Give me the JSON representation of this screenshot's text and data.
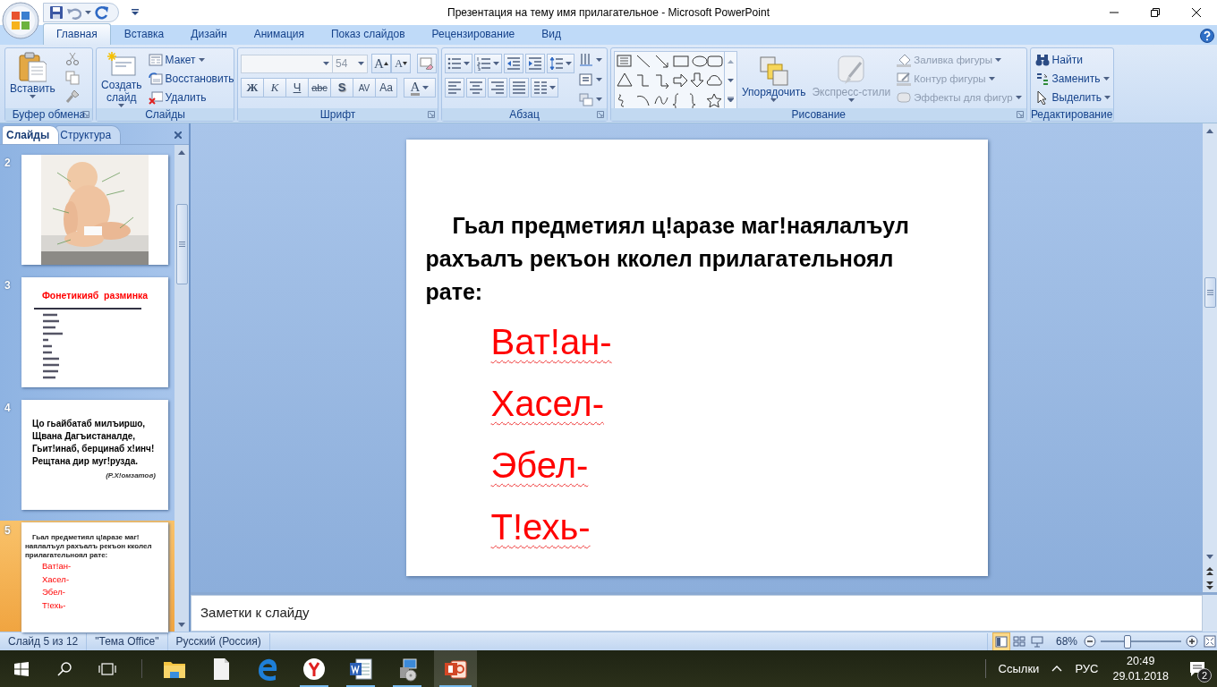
{
  "window": {
    "title": "Презентация на тему имя прилагательное - Microsoft PowerPoint"
  },
  "ribbon_tabs": [
    {
      "label": "Главная",
      "selected": true
    },
    {
      "label": "Вставка",
      "selected": false
    },
    {
      "label": "Дизайн",
      "selected": false
    },
    {
      "label": "Анимация",
      "selected": false
    },
    {
      "label": "Показ слайдов",
      "selected": false
    },
    {
      "label": "Рецензирование",
      "selected": false
    },
    {
      "label": "Вид",
      "selected": false
    }
  ],
  "clipboard": {
    "label": "Буфер обмена",
    "paste": "Вставить"
  },
  "slides_group": {
    "label": "Слайды",
    "new_slide": "Создать слайд",
    "buttons": [
      "Макет",
      "Восстановить",
      "Удалить"
    ]
  },
  "font": {
    "label": "Шрифт",
    "size": "54",
    "grow_shrink": [
      "A",
      "A"
    ],
    "format_buttons": [
      "Ж",
      "К",
      "Ч",
      "abc",
      "S",
      "AV",
      "Aa"
    ],
    "color_button": "A"
  },
  "paragraph": {
    "label": "Абзац"
  },
  "drawing": {
    "label": "Рисование",
    "arrange": "Упорядочить",
    "quick_styles": {
      "label": "Экспресс-стили",
      "disabled": true
    },
    "shape_buttons": [
      {
        "label": "Заливка фигуры",
        "disabled": true
      },
      {
        "label": "Контур фигуры",
        "disabled": true
      },
      {
        "label": "Эффекты для фигур",
        "disabled": true
      }
    ]
  },
  "editing": {
    "label": "Редактирование",
    "buttons": [
      "Найти",
      "Заменить",
      "Выделить"
    ]
  },
  "panel": {
    "tabs": [
      {
        "label": "Слайды",
        "selected": true
      },
      {
        "label": "Структура",
        "selected": false
      }
    ],
    "thumbnails": [
      {
        "number": "2",
        "kind": "picture",
        "selected": false
      },
      {
        "number": "3",
        "kind": "title",
        "title": "Фонетикияб  разминка",
        "selected": false
      },
      {
        "number": "4",
        "kind": "poem",
        "lines": [
          "Цо гьайбатаб милъиршо,",
          "Щвана Дагъистаналде,",
          "Гьит!инаб, берцинаб х!инч!",
          "Рещтана дир муг!рузда."
        ],
        "author": "(Р.Х!омзатов)",
        "selected": false
      },
      {
        "number": "5",
        "kind": "list",
        "paragraph": "Гьал предметиял ц!аразе маг!наялалъул рахъалъ рекъон кколел прилагательноял рате:",
        "items": [
          "Ват!ан-",
          "Хасел-",
          "Эбел-",
          "Т!ехь-"
        ],
        "selected": true
      }
    ]
  },
  "slide": {
    "paragraph": "Гьал предметиял ц!аразе маг!наялалъул рахъалъ рекъон кколел прилагательноял рате:",
    "items": [
      "Ват!ан-",
      "Хасел-",
      "Эбел-",
      "Т!ехь-"
    ]
  },
  "notes": {
    "placeholder": "Заметки к слайду"
  },
  "status_bar": {
    "slide": "Слайд 5 из 12",
    "theme": "\"Тема Office\"",
    "language": "Русский (Россия)",
    "views": [
      {
        "kind": "normal",
        "selected": true
      },
      {
        "kind": "sorter",
        "selected": false
      },
      {
        "kind": "show",
        "selected": false
      }
    ],
    "zoom": "68%",
    "zoom_slider": {
      "level": 0.33
    }
  },
  "taskbar": {
    "apps": [
      {
        "kind": "explorer",
        "running": false,
        "selected": false
      },
      {
        "kind": "file",
        "running": false,
        "selected": false
      },
      {
        "kind": "edge",
        "running": false,
        "selected": false
      },
      {
        "kind": "yandex",
        "running": true,
        "selected": false
      },
      {
        "kind": "word",
        "running": true,
        "selected": false
      },
      {
        "kind": "installer",
        "running": true,
        "selected": false
      },
      {
        "kind": "powerpoint",
        "running": true,
        "selected": true
      }
    ],
    "links": "Ссылки",
    "language": "РУС",
    "time": "20:49",
    "date": "29.01.2018",
    "notifications": "2"
  }
}
